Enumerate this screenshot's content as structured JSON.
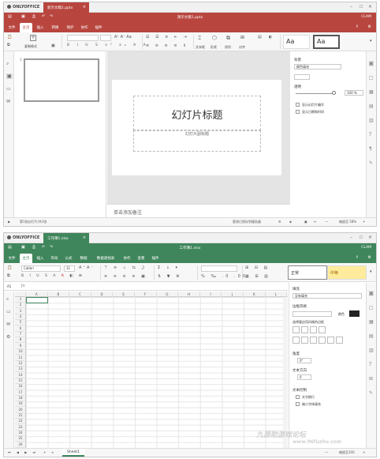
{
  "colors": {
    "pptx": "#b8463f",
    "xlsx": "#40865c",
    "tabs_bg": "#f1f1f1"
  },
  "presentation": {
    "app": "ONLYOFFICE",
    "tab": "新示文稿1.pptx",
    "title": "演示文稿1.pptx",
    "user": "CLAM",
    "menu": [
      "文件",
      "主页",
      "插入",
      "转换",
      "保护",
      "协作",
      "插件"
    ],
    "menu_active": 1,
    "ribbon": {
      "clone": "复制格式",
      "font_glyphs": "A⁺ A⁻ Aa",
      "styles": [
        "Aa",
        "Aa"
      ],
      "group_labels": [
        "文本框",
        "形状",
        "排列",
        "对齐",
        "版式",
        "颜色方案"
      ]
    },
    "slide_title": "幻灯片标题",
    "slide_subtitle": "幻灯片副标题",
    "notes": "单击添加备注",
    "slide_number": "1",
    "status_left": "第1张幻灯片/共1张",
    "status_mid": "更改已保存到服务器",
    "zoom": "缩放至 58%",
    "panel": {
      "bg_label": "背景",
      "bg_value": "颜色填充",
      "opacity_label": "透明",
      "opacity_value": "100 %",
      "check1": "显示幻灯片编号",
      "check2": "显示日期和时间"
    }
  },
  "spreadsheet": {
    "app": "ONLYOFFICE",
    "tab": "工作簿1.xlsx",
    "title": "工作簿1.xlsx",
    "user": "CLAM",
    "menu": [
      "文件",
      "主页",
      "插入",
      "布局",
      "公式",
      "数据",
      "数据透视表",
      "协作",
      "查看",
      "插件"
    ],
    "menu_active": 1,
    "font": "Calibri",
    "size": "11",
    "style1": "正常",
    "style2": "中等",
    "cell_ref": "A1",
    "columns": [
      "A",
      "B",
      "C",
      "D",
      "E",
      "F",
      "G",
      "H",
      "I",
      "J",
      "K",
      "L"
    ],
    "rows": [
      "1",
      "2",
      "3",
      "4",
      "5",
      "6",
      "7",
      "8",
      "9",
      "10",
      "11",
      "12",
      "13",
      "14",
      "15",
      "16",
      "17",
      "18",
      "19",
      "20",
      "21",
      "22",
      "23",
      "24",
      "25",
      "26"
    ],
    "sheet": "Sheet1",
    "zoom": "缩放至100",
    "panel": {
      "fill": "填充",
      "fill_value": "没有填充",
      "border": "边框风格",
      "color": "颜色",
      "border_hint": "选择要应用风格的边框",
      "angle": "角度",
      "angle_value": "0°",
      "indent": "文本方向",
      "indent_value": "0",
      "text_control": "文本控制",
      "wrap": "文字换行",
      "shrink": "缩小字体填充"
    }
  },
  "watermark": "九游助游戏论坛",
  "watermark_url": "www.96fuzhu.com"
}
